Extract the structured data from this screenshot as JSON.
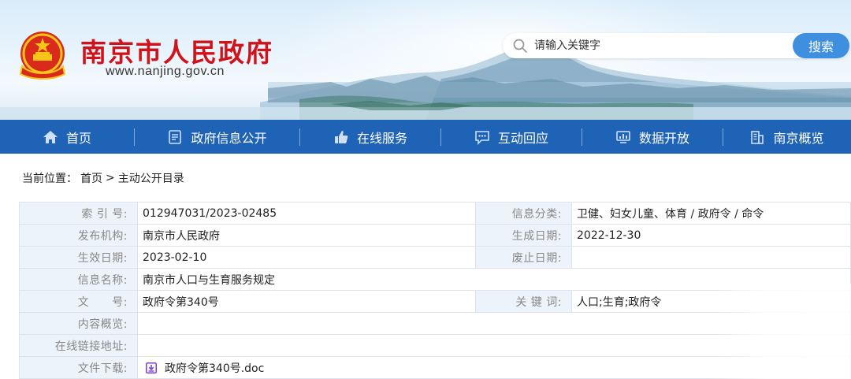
{
  "header": {
    "site_title": "南京市人民政府",
    "site_url": "www.nanjing.gov.cn",
    "search": {
      "placeholder": "请输入关键字",
      "button_label": "搜索"
    }
  },
  "nav": {
    "items": [
      {
        "label": "首页",
        "icon": "home-icon"
      },
      {
        "label": "政府信息公开",
        "icon": "document-icon"
      },
      {
        "label": "在线服务",
        "icon": "thumbs-up-icon"
      },
      {
        "label": "互动回应",
        "icon": "chat-bubble-icon"
      },
      {
        "label": "数据开放",
        "icon": "chart-monitor-icon"
      },
      {
        "label": "南京概览",
        "icon": "building-icon"
      }
    ]
  },
  "breadcrumb": {
    "prefix": "当前位置：",
    "items": [
      "首页",
      "主动公开目录"
    ],
    "separator": ">"
  },
  "info": {
    "index_no": {
      "label": "索 引 号:",
      "value": "012947031/2023-02485"
    },
    "category": {
      "label": "信息分类:",
      "value": "卫健、妇女儿童、体育 / 政府令 / 命令"
    },
    "publisher": {
      "label": "发布机构:",
      "value": "南京市人民政府"
    },
    "created": {
      "label": "生成日期:",
      "value": "2022-12-30"
    },
    "effective": {
      "label": "生效日期:",
      "value": "2023-02-10"
    },
    "abolished": {
      "label": "废止日期:",
      "value": ""
    },
    "name": {
      "label": "信息名称:",
      "value": "南京市人口与生育服务规定"
    },
    "doc_no": {
      "label": "文　　号:",
      "value": "政府令第340号"
    },
    "keywords": {
      "label": "关 键 词:",
      "value": "人口;生育;政府令"
    },
    "summary": {
      "label": "内容概览:",
      "value": ""
    },
    "online_link": {
      "label": "在线链接地址:",
      "value": ""
    },
    "download": {
      "label": "文件下载:",
      "file_name": "政府令第340号.doc",
      "icon": "download-icon"
    }
  },
  "colors": {
    "brand_red": "#d0121b",
    "nav_blue": "#1f63b6",
    "search_button": "#3f8fe0",
    "label_bg": "#edf3fa",
    "download_icon": "#7b3fd0"
  }
}
